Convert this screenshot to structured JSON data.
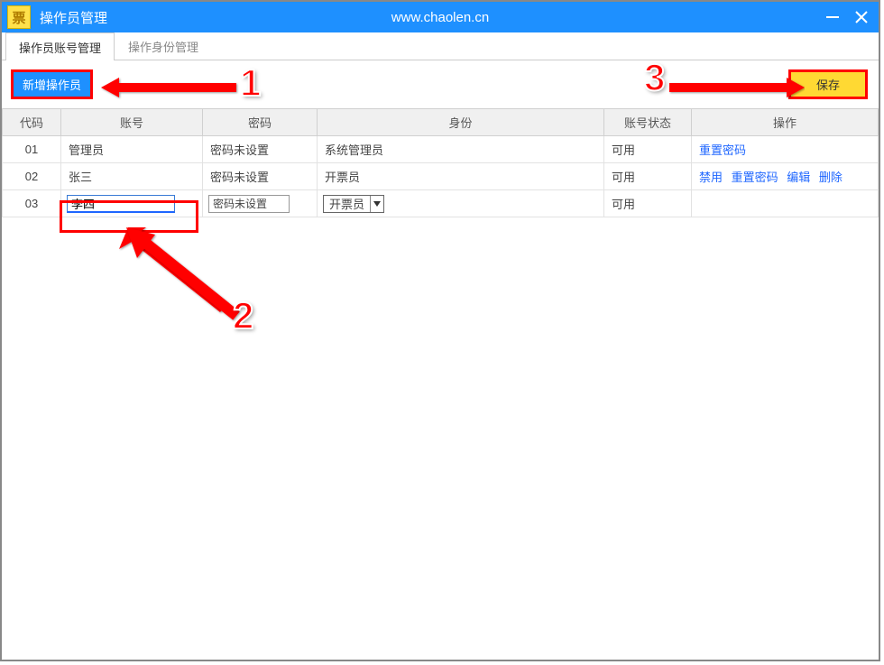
{
  "titlebar": {
    "app_icon_char": "票",
    "title": "操作员管理",
    "url": "www.chaolen.cn"
  },
  "tabs": {
    "active": "操作员账号管理",
    "inactive": "操作身份管理"
  },
  "toolbar": {
    "add_label": "新增操作员",
    "save_label": "保存"
  },
  "columns": {
    "code": "代码",
    "account": "账号",
    "password": "密码",
    "role": "身份",
    "status": "账号状态",
    "ops": "操作"
  },
  "rows": [
    {
      "code": "01",
      "account": "管理员",
      "password": "密码未设置",
      "role": "系统管理员",
      "status": "可用",
      "ops": [
        "重置密码"
      ]
    },
    {
      "code": "02",
      "account": "张三",
      "password": "密码未设置",
      "role": "开票员",
      "status": "可用",
      "ops": [
        "禁用",
        "重置密码",
        "编辑",
        "删除"
      ]
    },
    {
      "code": "03",
      "account_input": "李四",
      "password_input": "密码未设置",
      "role_select": "开票员",
      "status": "可用",
      "ops": []
    }
  ],
  "annotations": {
    "n1": "1",
    "n2": "2",
    "n3": "3"
  }
}
